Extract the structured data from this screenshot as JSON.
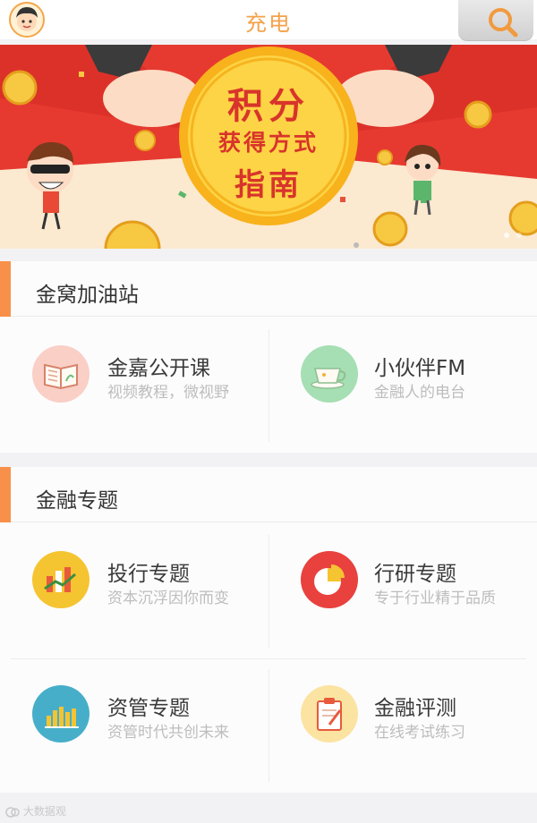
{
  "header": {
    "title": "充电"
  },
  "banner": {
    "line1": "积分",
    "line2": "获得方式",
    "line3": "指南"
  },
  "sections": [
    {
      "title": "金窝加油站",
      "items": [
        {
          "title": "金嘉公开课",
          "subtitle": "视频教程，微视野",
          "icon": "book-icon",
          "color": "#f9cfc6"
        },
        {
          "title": "小伙伴FM",
          "subtitle": "金融人的电台",
          "icon": "teacup-icon",
          "color": "#a6dfb3"
        }
      ]
    },
    {
      "title": "金融专题",
      "items": [
        {
          "title": "投行专题",
          "subtitle": "资本沉浮因你而变",
          "icon": "bar-chart-icon",
          "color": "#f5c431"
        },
        {
          "title": "行研专题",
          "subtitle": "专于行业精于品质",
          "icon": "pie-chart-icon",
          "color": "#e8413e"
        },
        {
          "title": "资管专题",
          "subtitle": "资管时代共创未来",
          "icon": "column-chart-icon",
          "color": "#47aec9"
        },
        {
          "title": "金融评测",
          "subtitle": "在线考试练习",
          "icon": "clipboard-icon",
          "color": "#fbe3a2"
        }
      ]
    }
  ],
  "watermark": "大数据观"
}
